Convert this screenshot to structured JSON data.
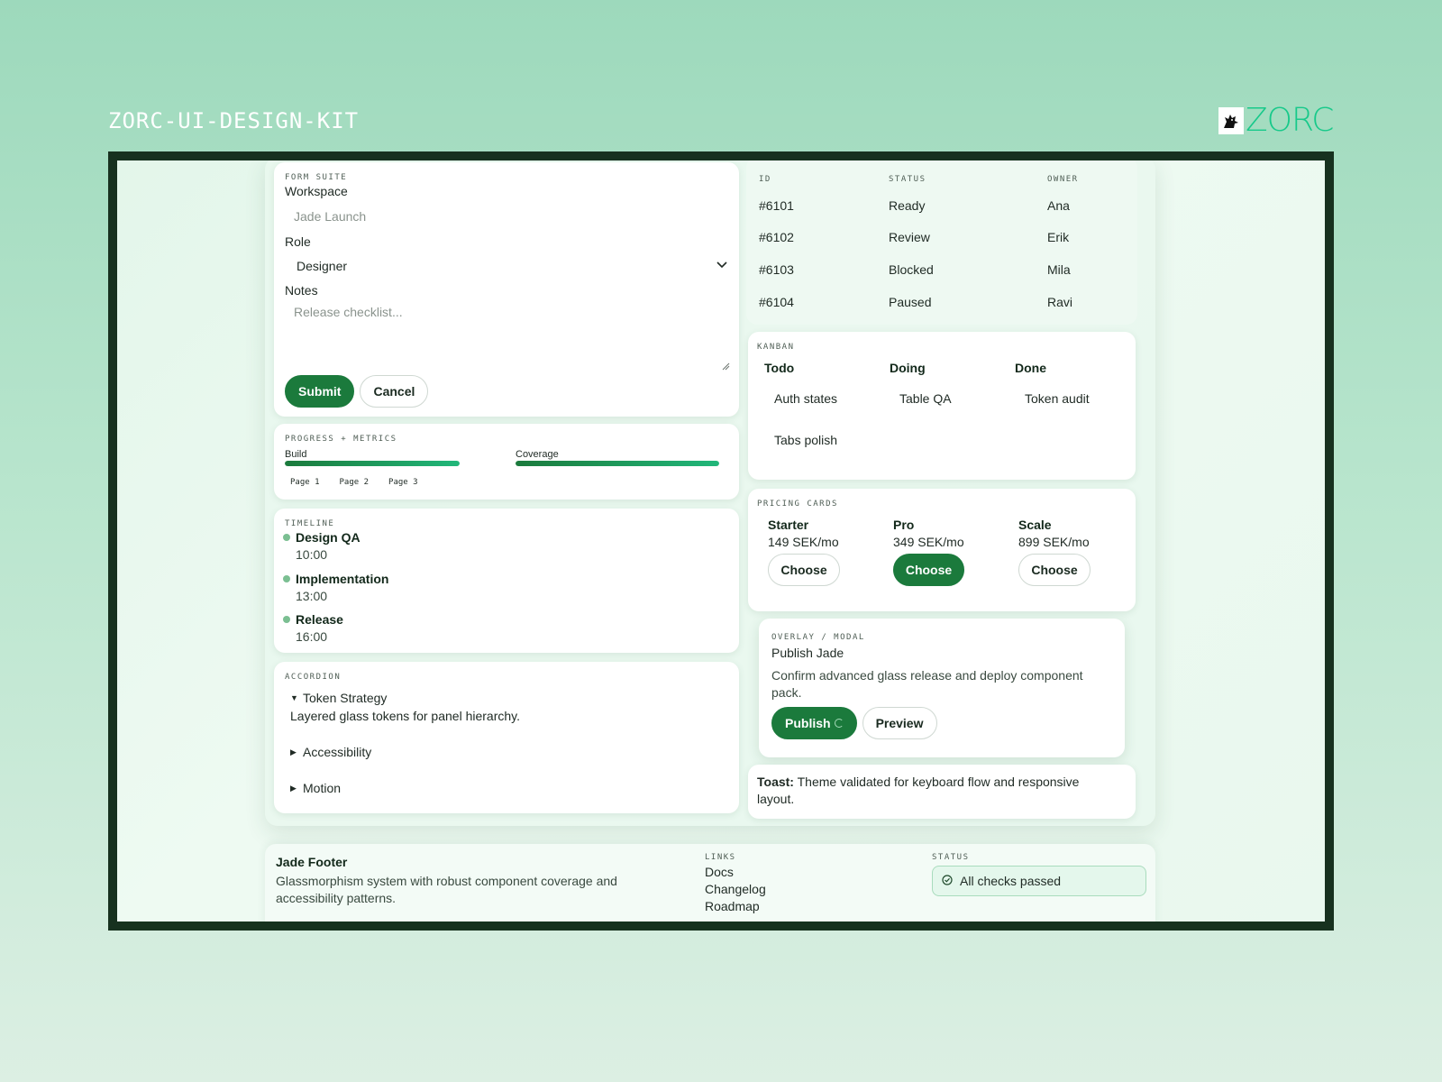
{
  "kit_title": "ZORC-UI-DESIGN-KIT",
  "brand": {
    "name": "ZORC",
    "accent": "#17c98a"
  },
  "colors": {
    "primary": "#1b7a3c",
    "frame": "#17311f",
    "background": "#9dd9bc"
  },
  "form": {
    "eyebrow": "FORM SUITE",
    "workspace_label": "Workspace",
    "workspace_placeholder": "Jade Launch",
    "role_label": "Role",
    "role_value": "Designer",
    "notes_label": "Notes",
    "notes_placeholder": "Release checklist...",
    "submit": "Submit",
    "cancel": "Cancel"
  },
  "progress": {
    "eyebrow": "PROGRESS + METRICS",
    "bars": [
      {
        "label": "Build",
        "percent": 100
      },
      {
        "label": "Coverage",
        "percent": 100
      }
    ],
    "pages": [
      "Page 1",
      "Page 2",
      "Page 3"
    ]
  },
  "timeline": {
    "eyebrow": "TIMELINE",
    "items": [
      {
        "title": "Design QA",
        "time": "10:00"
      },
      {
        "title": "Implementation",
        "time": "13:00"
      },
      {
        "title": "Release",
        "time": "16:00"
      }
    ]
  },
  "accordion": {
    "eyebrow": "ACCORDION",
    "items": [
      {
        "title": "Token Strategy",
        "open": true,
        "body": "Layered glass tokens for panel hierarchy."
      },
      {
        "title": "Accessibility",
        "open": false
      },
      {
        "title": "Motion",
        "open": false
      }
    ]
  },
  "table": {
    "headers": [
      "ID",
      "STATUS",
      "OWNER"
    ],
    "rows": [
      [
        "#6101",
        "Ready",
        "Ana"
      ],
      [
        "#6102",
        "Review",
        "Erik"
      ],
      [
        "#6103",
        "Blocked",
        "Mila"
      ],
      [
        "#6104",
        "Paused",
        "Ravi"
      ]
    ]
  },
  "kanban": {
    "eyebrow": "KANBAN",
    "columns": [
      {
        "title": "Todo",
        "cards": [
          "Auth states",
          "Tabs polish"
        ]
      },
      {
        "title": "Doing",
        "cards": [
          "Table QA"
        ]
      },
      {
        "title": "Done",
        "cards": [
          "Token audit"
        ]
      }
    ]
  },
  "pricing": {
    "eyebrow": "PRICING CARDS",
    "plans": [
      {
        "name": "Starter",
        "price": "149 SEK/mo",
        "cta": "Choose",
        "featured": false
      },
      {
        "name": "Pro",
        "price": "349 SEK/mo",
        "cta": "Choose",
        "featured": true
      },
      {
        "name": "Scale",
        "price": "899 SEK/mo",
        "cta": "Choose",
        "featured": false
      }
    ]
  },
  "modal": {
    "eyebrow": "OVERLAY / MODAL",
    "title": "Publish Jade",
    "body": "Confirm advanced glass release and deploy component pack.",
    "publish": "Publish",
    "preview": "Preview"
  },
  "toast": {
    "label": "Toast:",
    "message": " Theme validated for keyboard flow and responsive layout."
  },
  "footer": {
    "title": "Jade Footer",
    "description": "Glassmorphism system with robust component coverage and accessibility patterns.",
    "links_eyebrow": "LINKS",
    "links": [
      "Docs",
      "Changelog",
      "Roadmap"
    ],
    "status_eyebrow": "STATUS",
    "status_text": "All checks passed"
  }
}
